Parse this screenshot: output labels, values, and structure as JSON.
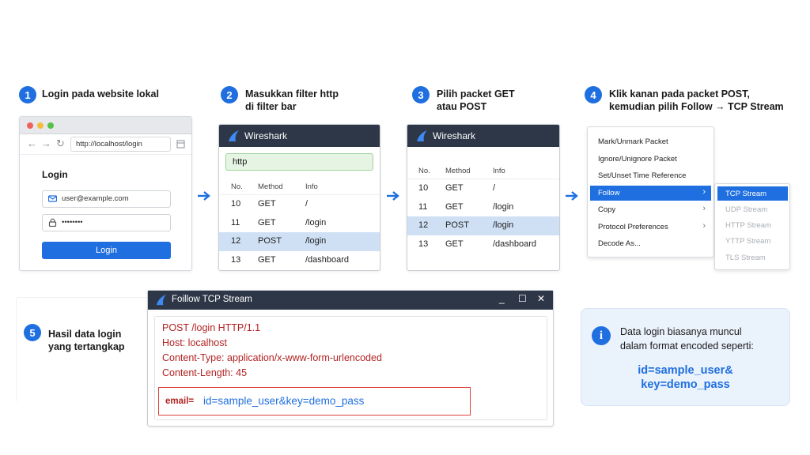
{
  "steps": [
    {
      "number": "1",
      "title_lines": [
        "Login pada website lokal"
      ]
    },
    {
      "number": "2",
      "title_lines": [
        "Masukkan filter http",
        "di filter bar"
      ]
    },
    {
      "number": "3",
      "title_lines": [
        "Pilih packet GET",
        "atau POST"
      ]
    },
    {
      "number": "4",
      "title_lines": [
        "Klik kanan pada packet POST,",
        "kemudian pilih Follow → TCP Stream"
      ]
    },
    {
      "number": "5",
      "title_lines": [
        "Hasil data login",
        "yang tertangkap"
      ]
    }
  ],
  "browser": {
    "url": "http://localhost/login",
    "login_title": "Login",
    "email_value": "user@example.com",
    "password_value": "••••••••",
    "login_button": "Login"
  },
  "wireshark_filter": {
    "title": "Wireshark",
    "filter_value": "http",
    "columns": [
      "No.",
      "Method",
      "Info"
    ],
    "rows": [
      {
        "no": "10",
        "method": "GET",
        "info": "/"
      },
      {
        "no": "11",
        "method": "GET",
        "info": "/login"
      },
      {
        "no": "12",
        "method": "POST",
        "info": "/login",
        "selected": true
      },
      {
        "no": "13",
        "method": "GET",
        "info": "/dashboard"
      }
    ]
  },
  "wireshark_select": {
    "title": "Wireshark",
    "columns": [
      "No.",
      "Method",
      "Info"
    ],
    "rows": [
      {
        "no": "10",
        "method": "GET",
        "info": "/"
      },
      {
        "no": "11",
        "method": "GET",
        "info": "/login"
      },
      {
        "no": "12",
        "method": "POST",
        "info": "/login",
        "selected": true
      },
      {
        "no": "13",
        "method": "GET",
        "info": "/dashboard"
      }
    ]
  },
  "context_menu": {
    "items": [
      {
        "label": "Mark/Unmark Packet",
        "submenu": false,
        "highlighted": false
      },
      {
        "label": "Ignore/Unignore Packet",
        "submenu": false,
        "highlighted": false
      },
      {
        "label": "Set/Unset Time Reference",
        "submenu": false,
        "highlighted": false
      },
      {
        "label": "Follow",
        "submenu": true,
        "highlighted": true
      },
      {
        "label": "Copy",
        "submenu": true,
        "highlighted": false
      },
      {
        "label": "Protocol Preferences",
        "submenu": true,
        "highlighted": false
      },
      {
        "label": "Decode As...",
        "submenu": false,
        "highlighted": false
      }
    ],
    "submenu_items": [
      {
        "label": "TCP Stream",
        "highlighted": true
      },
      {
        "label": "UDP Stream",
        "highlighted": false
      },
      {
        "label": "HTTP Stream",
        "highlighted": false
      },
      {
        "label": "YTTP Stream",
        "highlighted": false
      },
      {
        "label": "TLS Stream",
        "highlighted": false
      }
    ]
  },
  "tcp_stream": {
    "title": "Foillow TCP Stream",
    "window_buttons": [
      "_",
      "☐",
      "✕"
    ],
    "lines": [
      "POST /login HTTP/1.1",
      "Host: localhost",
      "Content-Type: application/x-www-form-urlencoded",
      "Content-Length: 45"
    ],
    "email_key": "email=",
    "email_value": "id=sample_user&key=demo_pass"
  },
  "info_box": {
    "icon": "i",
    "text_lines": [
      "Data login biasanya muncul",
      "dalam format encoded seperti:"
    ],
    "code_lines": [
      "id=sample_user&",
      "key=demo_pass"
    ]
  },
  "colors": {
    "accent": "#1f6fe0",
    "titlebar": "#2e3747",
    "selected_row": "#cfe0f5",
    "filter_bg": "#e6f5e3",
    "stream_text": "#b22222",
    "highlight_border": "#e0403a"
  }
}
